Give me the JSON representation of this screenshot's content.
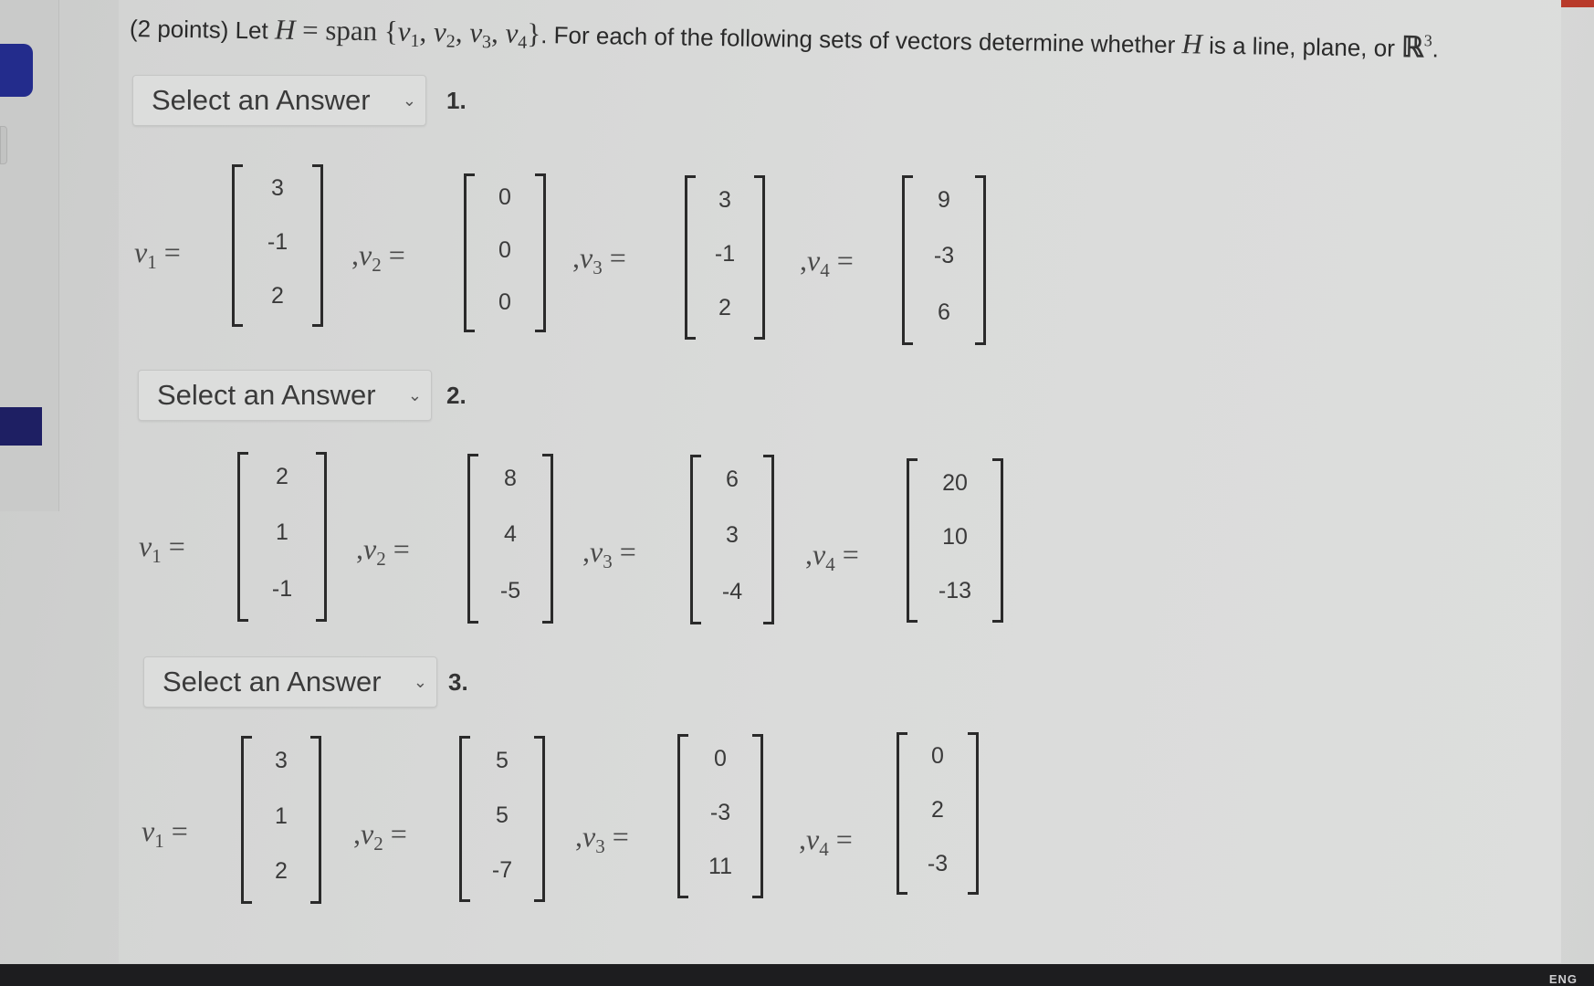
{
  "question": {
    "prefix": "(2 points) Let ",
    "H": "H",
    "equals_span": " = span ",
    "set_open": "{",
    "vars": [
      "v",
      "v",
      "v",
      "v"
    ],
    "subs": [
      "1",
      "2",
      "3",
      "4"
    ],
    "set_close": "}",
    "suffix": ". For each of the following sets of vectors determine whether ",
    "H2": "H",
    "suffix2": " is a line, plane, or ",
    "R": "ℝ",
    "R_sup": "3",
    "end": "."
  },
  "select_placeholder": "Select an Answer",
  "chevron": "⌄",
  "parts": [
    {
      "number": "1.",
      "answer": "Select an Answer",
      "vectors": [
        {
          "label": "v",
          "sub": "1",
          "prefix": "",
          "values": [
            "3",
            "-1",
            "2"
          ]
        },
        {
          "label": "v",
          "sub": "2",
          "prefix": ",",
          "values": [
            "0",
            "0",
            "0"
          ]
        },
        {
          "label": "v",
          "sub": "3",
          "prefix": ",",
          "values": [
            "3",
            "-1",
            "2"
          ]
        },
        {
          "label": "v",
          "sub": "4",
          "prefix": ",",
          "values": [
            "9",
            "-3",
            "6"
          ]
        }
      ]
    },
    {
      "number": "2.",
      "answer": "Select an Answer",
      "vectors": [
        {
          "label": "v",
          "sub": "1",
          "prefix": "",
          "values": [
            "2",
            "1",
            "-1"
          ]
        },
        {
          "label": "v",
          "sub": "2",
          "prefix": ",",
          "values": [
            "8",
            "4",
            "-5"
          ]
        },
        {
          "label": "v",
          "sub": "3",
          "prefix": ",",
          "values": [
            "6",
            "3",
            "-4"
          ]
        },
        {
          "label": "v",
          "sub": "4",
          "prefix": ",",
          "values": [
            "20",
            "10",
            "-13"
          ]
        }
      ]
    },
    {
      "number": "3.",
      "answer": "Select an Answer",
      "vectors": [
        {
          "label": "v",
          "sub": "1",
          "prefix": "",
          "values": [
            "3",
            "1",
            "2"
          ]
        },
        {
          "label": "v",
          "sub": "2",
          "prefix": ",",
          "values": [
            "5",
            "5",
            "-7"
          ]
        },
        {
          "label": "v",
          "sub": "3",
          "prefix": ",",
          "values": [
            "0",
            "-3",
            "11"
          ]
        },
        {
          "label": "v",
          "sub": "4",
          "prefix": ",",
          "values": [
            "0",
            "2",
            "-3"
          ]
        }
      ]
    }
  ],
  "taskbar": {
    "language": "ENG"
  },
  "colors": {
    "sidebar_accent": "#232c8c",
    "sidebar_dark": "#1e1f63",
    "top_accent": "#b83a2a"
  }
}
